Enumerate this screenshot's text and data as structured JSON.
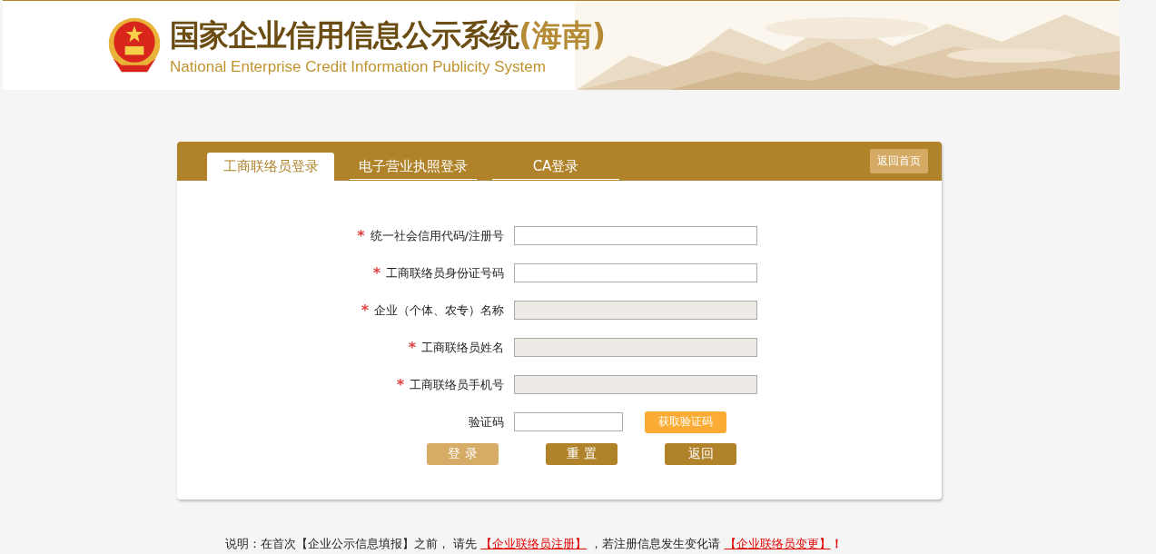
{
  "header": {
    "title": "国家企业信用信息公示系统",
    "region": "(海南)",
    "subtitle": "National Enterprise Credit Information Publicity System"
  },
  "tabs": [
    {
      "label": "工商联络员登录",
      "selected": true
    },
    {
      "label": "电子营业执照登录",
      "selected": false
    },
    {
      "label": "CA登录",
      "selected": false
    }
  ],
  "home_button": "返回首页",
  "fields": [
    {
      "label": "统一社会信用代码/注册号",
      "required": true,
      "disabled": false,
      "kind": "wide"
    },
    {
      "label": "工商联络员身份证号码",
      "required": true,
      "disabled": false,
      "kind": "wide"
    },
    {
      "label": "企业（个体、农专）名称",
      "required": true,
      "disabled": true,
      "kind": "wide"
    },
    {
      "label": "工商联络员姓名",
      "required": true,
      "disabled": true,
      "kind": "wide"
    },
    {
      "label": "工商联络员手机号",
      "required": true,
      "disabled": true,
      "kind": "wide"
    },
    {
      "label": "验证码",
      "required": false,
      "disabled": false,
      "kind": "code",
      "button": "获取验证码"
    }
  ],
  "required_mark": "*",
  "buttons": [
    {
      "label": "登 录",
      "kind": "light"
    },
    {
      "label": "重 置",
      "kind": "dark"
    },
    {
      "label": "返回",
      "kind": "dark"
    }
  ],
  "note": [
    {
      "kind": "text",
      "text": "说明：在首次【企业公示信息填报】之前， 请先 "
    },
    {
      "kind": "link",
      "text": "【企业联络员注册】"
    },
    {
      "kind": "text",
      "text": " ，若注册信息发生变化请 "
    },
    {
      "kind": "link",
      "text": "【企业联络员变更】"
    },
    {
      "kind": "alert",
      "text": "！"
    }
  ]
}
